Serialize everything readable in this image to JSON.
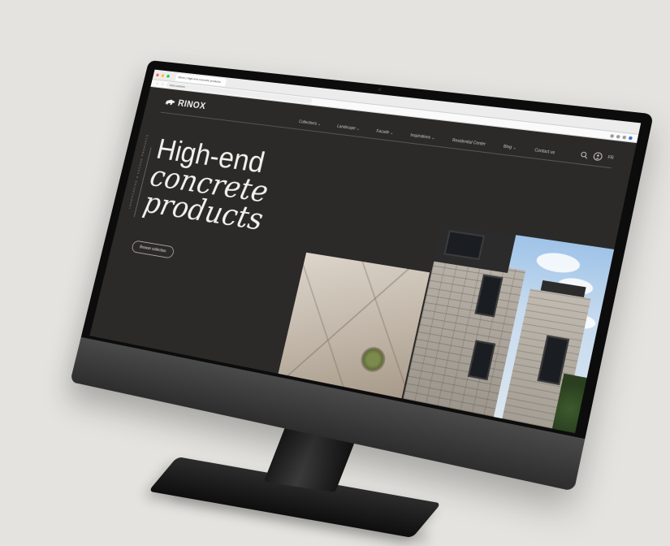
{
  "browser": {
    "tab_title": "Rinox | High-end concrete products",
    "address": "rinox.com/en",
    "window_dots": [
      "#ff5f57",
      "#febc2e",
      "#28c840"
    ]
  },
  "site": {
    "brand": "RINOX",
    "nav": [
      {
        "label": "Collections ⌄"
      },
      {
        "label": "Landscape ⌄"
      },
      {
        "label": "Facade ⌄"
      },
      {
        "label": "Inspirations ⌄"
      },
      {
        "label": "Residential Center"
      },
      {
        "label": "Blog ⌄"
      },
      {
        "label": "Contact us"
      }
    ],
    "lang": "FR",
    "hero": {
      "line1": "High-end",
      "line2": "concrete",
      "line3": "products",
      "vertical_caption": "LANDSCAPING & FACADE PRODUCTS",
      "cta": "Browse collection"
    }
  },
  "colors": {
    "site_background": "#2b2a28",
    "page_background": "#e4e3df",
    "hero_text": "#f3f1ec"
  }
}
